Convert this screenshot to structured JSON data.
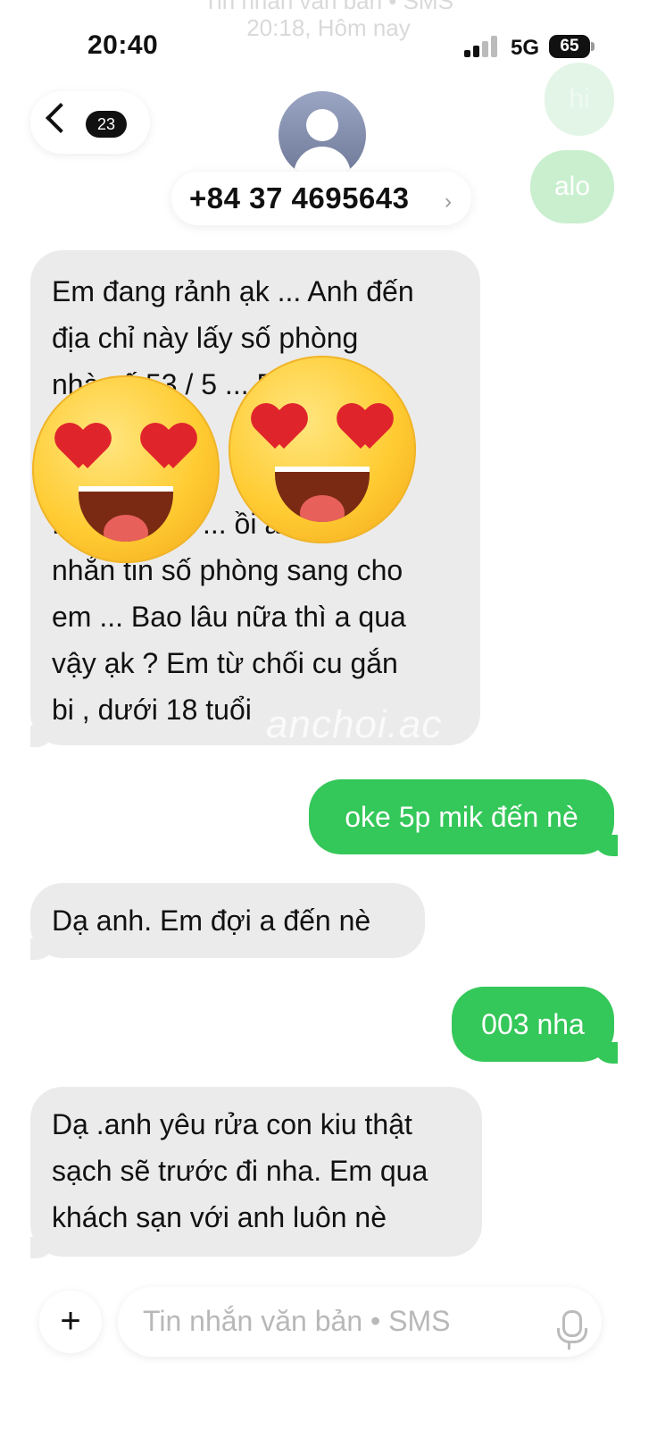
{
  "status_bar": {
    "time": "20:40",
    "network": "5G",
    "battery": "65"
  },
  "faded_header": {
    "line1": "Tin nhắn văn bản • SMS",
    "line2": "20:18, Hôm nay"
  },
  "nav": {
    "unread_count": "23",
    "contact_number": "+84 37 4695643",
    "chevron": "›"
  },
  "faded_bubbles": [
    "hi",
    "alo"
  ],
  "messages": [
    {
      "direction": "incoming",
      "text": "Em đang rảnh ạk ... Anh đến\nđịa chỉ này lấy số phòng\nnhà số 53 / 5 ... Bùi\n... tư ... ận\n... n\n... Ngọc Hà ... ồi anh\nnhắn tin số phòng sang cho\nem ... Bao lâu nữa thì a qua\nvậy ạk ? Em từ chối cu gắn\nbi , dưới 18 tuổi"
    },
    {
      "direction": "outgoing",
      "text": "oke 5p mik đến nè"
    },
    {
      "direction": "incoming",
      "text": "Dạ anh. Em đợi a đến nè"
    },
    {
      "direction": "outgoing",
      "text": "003 nha"
    },
    {
      "direction": "incoming",
      "text": "Dạ .anh yêu rửa con kiu thật\nsạch sẽ trước đi nha. Em qua\nkhách sạn với anh luôn nè"
    }
  ],
  "watermark": "anchoi.ac",
  "composer": {
    "plus": "+",
    "placeholder": "Tin nhắn văn bản • SMS"
  },
  "icons": {
    "back": "chevron-left-icon",
    "mic": "microphone-icon",
    "emoji": "heart-eyes-emoji"
  },
  "colors": {
    "outgoing": "#34c759",
    "incoming": "#ebebeb"
  }
}
